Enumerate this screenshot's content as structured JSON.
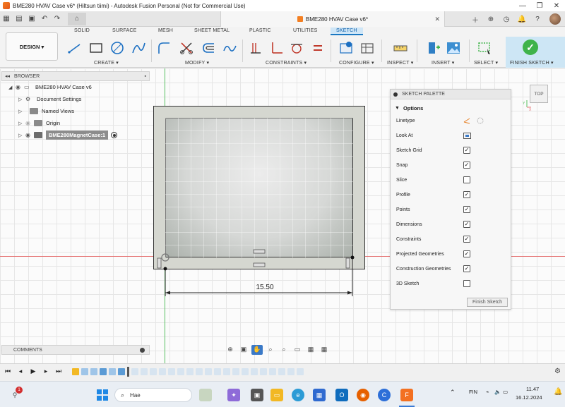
{
  "window": {
    "title": "BME280 HVAV Case v6* (Hiltsun tiimi) - Autodesk Fusion Personal (Not for Commercial Use)",
    "minimize": "—",
    "restore": "❐",
    "close": "✕"
  },
  "document_tab": {
    "label": "BME280 HVAV Case v6*",
    "close": "✕"
  },
  "ribbon": {
    "design_label": "DESIGN ▾",
    "tabs": [
      "SOLID",
      "SURFACE",
      "MESH",
      "SHEET METAL",
      "PLASTIC",
      "UTILITIES",
      "SKETCH"
    ],
    "active_tab": "SKETCH",
    "groups": [
      "CREATE ▾",
      "MODIFY ▾",
      "CONSTRAINTS ▾",
      "CONFIGURE ▾",
      "INSPECT ▾",
      "INSERT ▾",
      "SELECT ▾",
      "FINISH SKETCH ▾"
    ]
  },
  "browser": {
    "header": "BROWSER",
    "items": [
      {
        "label": "BME280 HVAV Case v6",
        "level": 0
      },
      {
        "label": "Document Settings",
        "level": 1
      },
      {
        "label": "Named Views",
        "level": 1
      },
      {
        "label": "Origin",
        "level": 1
      },
      {
        "label": "BME280MagnetCase:1",
        "level": 1
      }
    ]
  },
  "comments": {
    "header": "COMMENTS"
  },
  "sketch_palette": {
    "header": "SKETCH PALETTE",
    "section": "Options",
    "options": [
      {
        "label": "Linetype",
        "type": "icons"
      },
      {
        "label": "Look At",
        "type": "icon"
      },
      {
        "label": "Sketch Grid",
        "checked": true
      },
      {
        "label": "Snap",
        "checked": true
      },
      {
        "label": "Slice",
        "checked": false
      },
      {
        "label": "Profile",
        "checked": true
      },
      {
        "label": "Points",
        "checked": true
      },
      {
        "label": "Dimensions",
        "checked": true
      },
      {
        "label": "Constraints",
        "checked": true
      },
      {
        "label": "Projected Geometries",
        "checked": true
      },
      {
        "label": "Construction Geometries",
        "checked": true
      },
      {
        "label": "3D Sketch",
        "checked": false
      }
    ],
    "finish_button": "Finish Sketch"
  },
  "viewcube": {
    "label": "TOP"
  },
  "dimension": {
    "value": "15.50"
  },
  "taskbar": {
    "search_placeholder": "Hae",
    "language": "FIN",
    "time": "11.47",
    "date": "16.12.2024",
    "notification_count": "1"
  },
  "colors": {
    "accent": "#1a78c2",
    "finish_sketch_bg": "#cde6f5",
    "check_green": "#3fb34a",
    "axis_green": "#58c060",
    "axis_red": "#e57373"
  }
}
